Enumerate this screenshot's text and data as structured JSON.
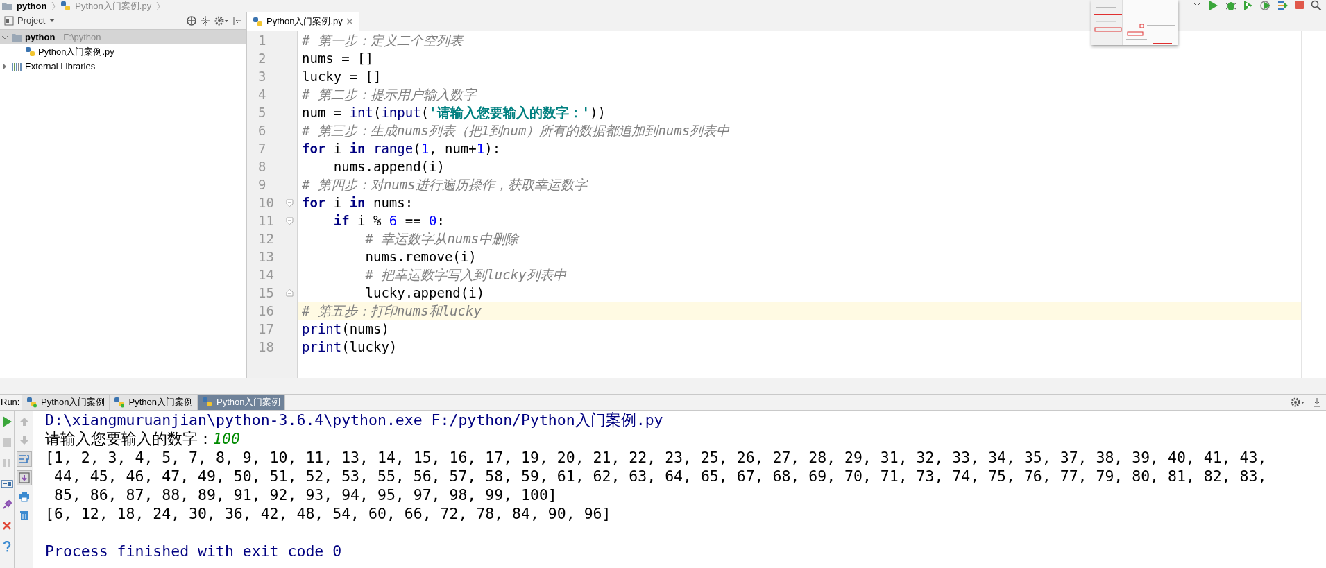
{
  "breadcrumb": [
    {
      "text": "python",
      "kind": "folder"
    },
    {
      "text": "Python入门案例.py",
      "kind": "file"
    }
  ],
  "project_panel": {
    "title": "Project",
    "tree": [
      {
        "label": "python",
        "path": "F:\\python",
        "kind": "folder",
        "selected": true,
        "expanded": true,
        "children": [
          {
            "label": "Python入门案例.py",
            "kind": "file",
            "selected": false
          }
        ]
      },
      {
        "label": "External Libraries",
        "kind": "library",
        "selected": false,
        "expanded": false
      }
    ]
  },
  "editor": {
    "tabs": [
      {
        "label": "Python入门案例.py",
        "selected": true
      }
    ],
    "lines": [
      {
        "number": "1",
        "current": false,
        "tokens": [
          {
            "kind": "comment",
            "text": "# 第一步：定义二个空列表"
          }
        ]
      },
      {
        "number": "2",
        "current": false,
        "tokens": [
          {
            "kind": "plain",
            "text": "nums = []"
          }
        ]
      },
      {
        "number": "3",
        "current": false,
        "tokens": [
          {
            "kind": "plain",
            "text": "lucky = []"
          }
        ]
      },
      {
        "number": "4",
        "current": false,
        "tokens": [
          {
            "kind": "comment",
            "text": "# 第二步：提示用户输入数字"
          }
        ]
      },
      {
        "number": "5",
        "current": false,
        "tokens": [
          {
            "kind": "plain",
            "text": "num = "
          },
          {
            "kind": "builtin",
            "text": "int"
          },
          {
            "kind": "plain",
            "text": "("
          },
          {
            "kind": "builtin",
            "text": "input"
          },
          {
            "kind": "plain",
            "text": "("
          },
          {
            "kind": "string",
            "text": "'请输入您要输入的数字：'"
          },
          {
            "kind": "plain",
            "text": "))"
          }
        ]
      },
      {
        "number": "6",
        "current": false,
        "tokens": [
          {
            "kind": "comment",
            "text": "# 第三步：生成nums列表（把1到num）所有的数据都追加到nums列表中"
          }
        ]
      },
      {
        "number": "7",
        "current": false,
        "tokens": [
          {
            "kind": "keyword",
            "text": "for"
          },
          {
            "kind": "plain",
            "text": " i "
          },
          {
            "kind": "keyword",
            "text": "in "
          },
          {
            "kind": "builtin",
            "text": "range"
          },
          {
            "kind": "plain",
            "text": "("
          },
          {
            "kind": "number",
            "text": "1"
          },
          {
            "kind": "plain",
            "text": ", num+"
          },
          {
            "kind": "number",
            "text": "1"
          },
          {
            "kind": "plain",
            "text": "):"
          }
        ]
      },
      {
        "number": "8",
        "current": false,
        "tokens": [
          {
            "kind": "plain",
            "text": "    nums.append(i)"
          }
        ]
      },
      {
        "number": "9",
        "current": false,
        "tokens": [
          {
            "kind": "comment",
            "text": "# 第四步：对nums进行遍历操作，获取幸运数字"
          }
        ]
      },
      {
        "number": "10",
        "current": false,
        "fold_start": true,
        "tokens": [
          {
            "kind": "keyword",
            "text": "for"
          },
          {
            "kind": "plain",
            "text": " i "
          },
          {
            "kind": "keyword",
            "text": "in"
          },
          {
            "kind": "plain",
            "text": " nums:"
          }
        ]
      },
      {
        "number": "11",
        "current": false,
        "fold_start": true,
        "tokens": [
          {
            "kind": "keyword",
            "text": "    if"
          },
          {
            "kind": "plain",
            "text": " i % "
          },
          {
            "kind": "number",
            "text": "6"
          },
          {
            "kind": "plain",
            "text": " == "
          },
          {
            "kind": "number",
            "text": "0"
          },
          {
            "kind": "plain",
            "text": ":"
          }
        ]
      },
      {
        "number": "12",
        "current": false,
        "tokens": [
          {
            "kind": "comment",
            "text": "        # 幸运数字从nums中删除"
          }
        ]
      },
      {
        "number": "13",
        "current": false,
        "tokens": [
          {
            "kind": "plain",
            "text": "        nums.remove(i)"
          }
        ]
      },
      {
        "number": "14",
        "current": false,
        "tokens": [
          {
            "kind": "comment",
            "text": "        # 把幸运数字写入到lucky列表中"
          }
        ]
      },
      {
        "number": "15",
        "current": false,
        "fold_end": true,
        "tokens": [
          {
            "kind": "plain",
            "text": "        lucky.append(i)"
          }
        ]
      },
      {
        "number": "16",
        "current": true,
        "tokens": [
          {
            "kind": "comment",
            "text": "# 第五步：打印nums和lucky"
          }
        ]
      },
      {
        "number": "17",
        "current": false,
        "tokens": [
          {
            "kind": "builtin",
            "text": "print"
          },
          {
            "kind": "plain",
            "text": "(nums)"
          }
        ]
      },
      {
        "number": "18",
        "current": false,
        "tokens": [
          {
            "kind": "builtin",
            "text": "print"
          },
          {
            "kind": "plain",
            "text": "(lucky)"
          }
        ]
      }
    ]
  },
  "run_panel": {
    "label": "Run:",
    "tabs": [
      {
        "label": "Python入门案例",
        "selected": false,
        "running": true
      },
      {
        "label": "Python入门案例",
        "selected": false,
        "running": true
      },
      {
        "label": "Python入门案例",
        "selected": true,
        "running": false
      }
    ],
    "side_tools": [
      {
        "kind": "rerun",
        "on": false
      },
      {
        "kind": "stop",
        "on": false
      },
      {
        "kind": "pause",
        "on": false
      },
      {
        "kind": "layout",
        "on": false
      },
      {
        "kind": "pin",
        "on": false
      },
      {
        "kind": "close",
        "on": false
      },
      {
        "kind": "help",
        "on": false
      }
    ],
    "output_tools": [
      {
        "kind": "up",
        "on": false
      },
      {
        "kind": "down",
        "on": false
      },
      {
        "kind": "soft-wrap",
        "on": true
      },
      {
        "kind": "scroll-end",
        "on": true
      },
      {
        "kind": "print",
        "on": false
      },
      {
        "kind": "clear",
        "on": false
      }
    ],
    "console": [
      {
        "parts": [
          {
            "kind": "system",
            "text": "D:\\xiangmuruanjian\\python-3.6.4\\python.exe F:/python/Python入门案例.py"
          }
        ]
      },
      {
        "parts": [
          {
            "kind": "stdout",
            "text": "请输入您要输入的数字："
          },
          {
            "kind": "input",
            "text": "100"
          }
        ]
      },
      {
        "parts": [
          {
            "kind": "stdout",
            "text": "[1, 2, 3, 4, 5, 7, 8, 9, 10, 11, 13, 14, 15, 16, 17, 19, 20, 21, 22, 23, 25, 26, 27, 28, 29, 31, 32, 33, 34, 35, 37, 38, 39, 40, 41, 43,"
          }
        ]
      },
      {
        "parts": [
          {
            "kind": "stdout",
            "text": " 44, 45, 46, 47, 49, 50, 51, 52, 53, 55, 56, 57, 58, 59, 61, 62, 63, 64, 65, 67, 68, 69, 70, 71, 73, 74, 75, 76, 77, 79, 80, 81, 82, 83,"
          }
        ]
      },
      {
        "parts": [
          {
            "kind": "stdout",
            "text": " 85, 86, 87, 88, 89, 91, 92, 93, 94, 95, 97, 98, 99, 100]"
          }
        ]
      },
      {
        "parts": [
          {
            "kind": "stdout",
            "text": "[6, 12, 18, 24, 30, 36, 42, 48, 54, 60, 66, 72, 78, 84, 90, 96]"
          }
        ]
      },
      {
        "kind": "exit",
        "parts": [
          {
            "kind": "system",
            "text": "Process finished with exit code 0"
          }
        ]
      }
    ]
  }
}
